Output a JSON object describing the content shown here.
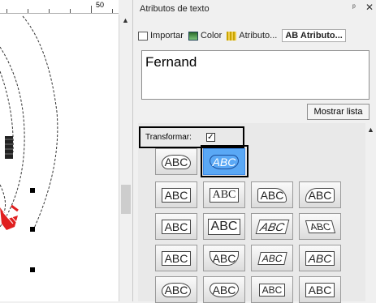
{
  "ruler": {
    "label": "50"
  },
  "panel": {
    "title": "Atributos de texto",
    "pin_icon": "pin-icon",
    "close_icon": "close-icon",
    "toolbar": [
      {
        "label": "Importar",
        "icon": "import-icon",
        "active": false
      },
      {
        "label": "Color",
        "icon": "color-icon",
        "active": false
      },
      {
        "label": "Atributo...",
        "icon": "attribute-icon",
        "active": false
      },
      {
        "label": "AB Atributo...",
        "icon": "text-attribute-icon",
        "active": true
      }
    ],
    "text_value": "Fernand",
    "list_button": "Mostrar lista",
    "transform_label": "Transformar:",
    "transform_checked": true
  },
  "shapes": {
    "row0": [
      "ABC",
      "ABC"
    ],
    "grid": [
      [
        "ABC",
        "ABC",
        "ABC",
        "ABC"
      ],
      [
        "ABC",
        "ABC",
        "ABC",
        "ABC"
      ],
      [
        "ABC",
        "ABC",
        "ABC",
        "ABC"
      ],
      [
        "ABC",
        "ABC",
        "ABC",
        "ABC"
      ]
    ],
    "selected": "row0.1"
  },
  "colors": {
    "selected_shape": "#5aa8f5",
    "design_thread": "#e02020"
  }
}
